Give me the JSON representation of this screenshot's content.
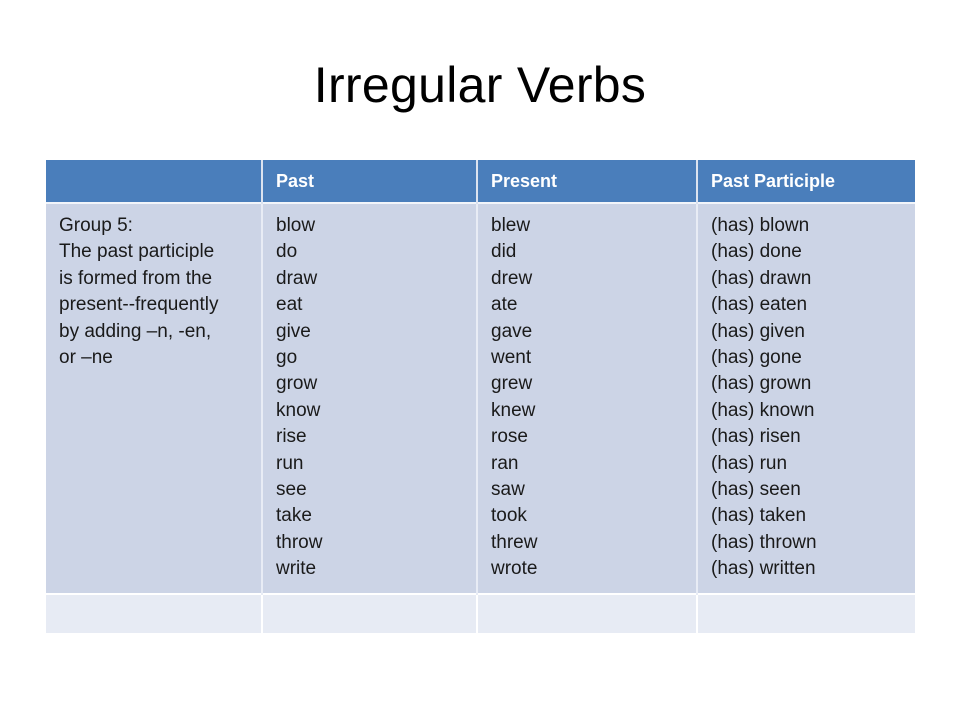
{
  "slide": {
    "title": "Irregular Verbs"
  },
  "table": {
    "headers": [
      "",
      "Past",
      "Present",
      "Past Participle"
    ],
    "group_label_lines": [
      "Group 5:",
      "The past participle",
      "is formed from the",
      "present--frequently",
      "by adding –n, -en,",
      "or –ne"
    ],
    "rows": [
      {
        "past": "blow",
        "present": "blew",
        "participle": "(has) blown"
      },
      {
        "past": "do",
        "present": "did",
        "participle": "(has) done"
      },
      {
        "past": "draw",
        "present": "drew",
        "participle": "(has) drawn"
      },
      {
        "past": "eat",
        "present": "ate",
        "participle": "(has) eaten"
      },
      {
        "past": "give",
        "present": "gave",
        "participle": "(has) given"
      },
      {
        "past": "go",
        "present": "went",
        "participle": "(has) gone"
      },
      {
        "past": "grow",
        "present": "grew",
        "participle": "(has) grown"
      },
      {
        "past": "know",
        "present": "knew",
        "participle": "(has) known"
      },
      {
        "past": "rise",
        "present": "rose",
        "participle": "(has) risen"
      },
      {
        "past": "run",
        "present": "ran",
        "participle": "(has) run"
      },
      {
        "past": "see",
        "present": "saw",
        "participle": "(has) seen"
      },
      {
        "past": "take",
        "present": "took",
        "participle": "(has) taken"
      },
      {
        "past": "throw",
        "present": "threw",
        "participle": "(has) thrown"
      },
      {
        "past": "write",
        "present": "wrote",
        "participle": "(has) written"
      }
    ],
    "empty_row_cells": [
      "",
      "",
      "",
      ""
    ]
  },
  "colors": {
    "header_fill": "#4a7ebb",
    "header_text": "#ffffff",
    "body_fill": "#ccd4e6",
    "empty_row_fill": "#e7ebf4",
    "body_text": "#1a1a1a",
    "slide_background": "#ffffff"
  }
}
